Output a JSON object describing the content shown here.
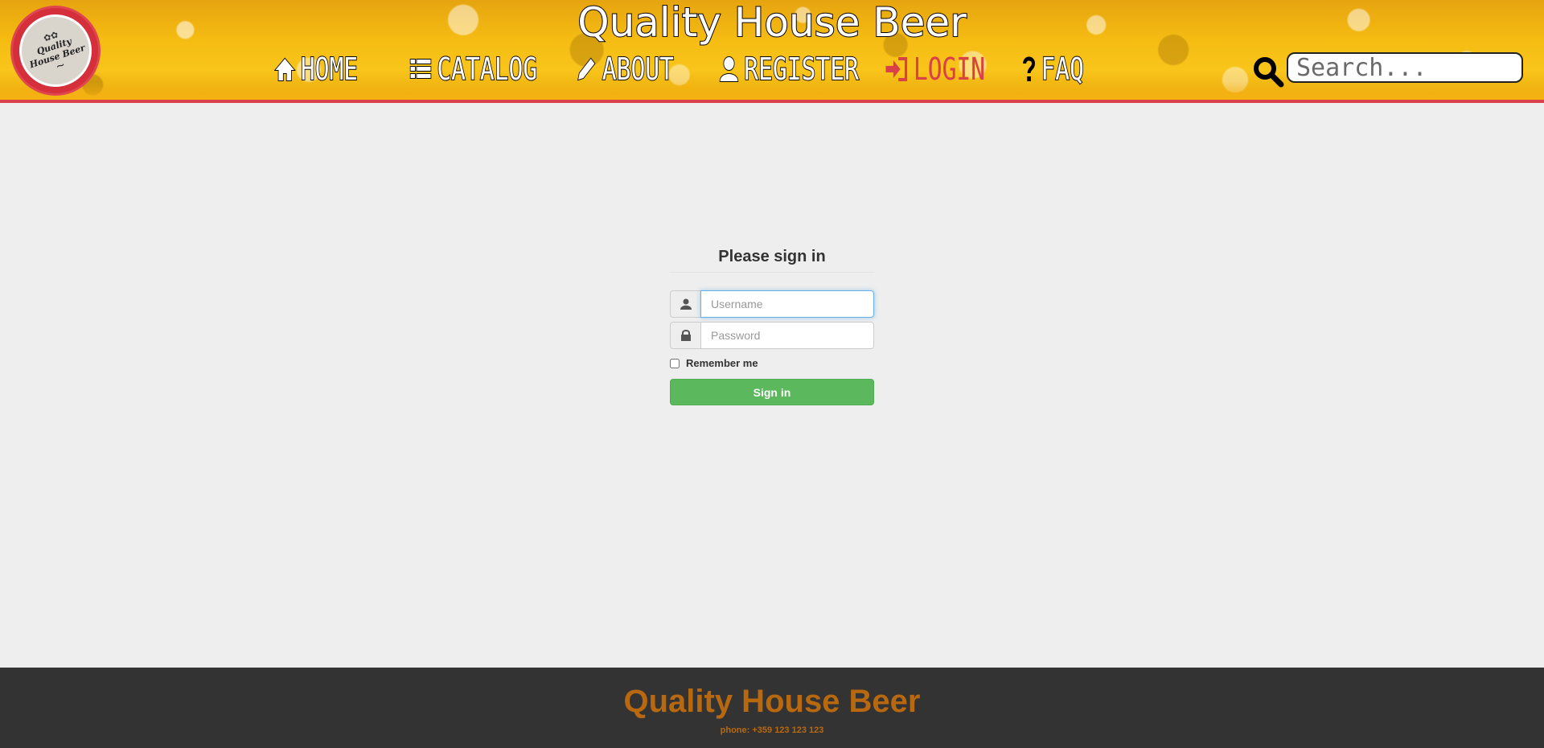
{
  "header": {
    "site_title": "Quality House Beer",
    "logo": {
      "text": "Quality House Beer",
      "icon": "hops-icon"
    },
    "nav": [
      {
        "label": "HOME",
        "icon": "home-icon"
      },
      {
        "label": "CATALOG",
        "icon": "list-icon"
      },
      {
        "label": "ABOUT",
        "icon": "pencil-icon"
      },
      {
        "label": "REGISTER",
        "icon": "user-icon"
      },
      {
        "label": "LOGIN",
        "icon": "sign-in-icon",
        "active": true
      },
      {
        "label": "FAQ",
        "icon": "question-icon"
      }
    ],
    "search": {
      "placeholder": "Search...",
      "value": "",
      "icon": "search-icon"
    }
  },
  "login": {
    "title": "Please sign in",
    "username": {
      "placeholder": "Username",
      "value": "",
      "icon": "user-icon"
    },
    "password": {
      "placeholder": "Password",
      "value": "",
      "icon": "lock-icon"
    },
    "remember_label": "Remember me",
    "remember_checked": false,
    "submit_label": "Sign in"
  },
  "footer": {
    "title": "Quality House Beer",
    "phone": "phone: +359 123 123 123"
  },
  "colors": {
    "accent_red": "#d9404a",
    "beer_yellow": "#f5bc12",
    "success_green": "#5cb85c",
    "footer_bg": "#333333",
    "footer_text": "#b8690f",
    "page_bg": "#eeeeee"
  }
}
